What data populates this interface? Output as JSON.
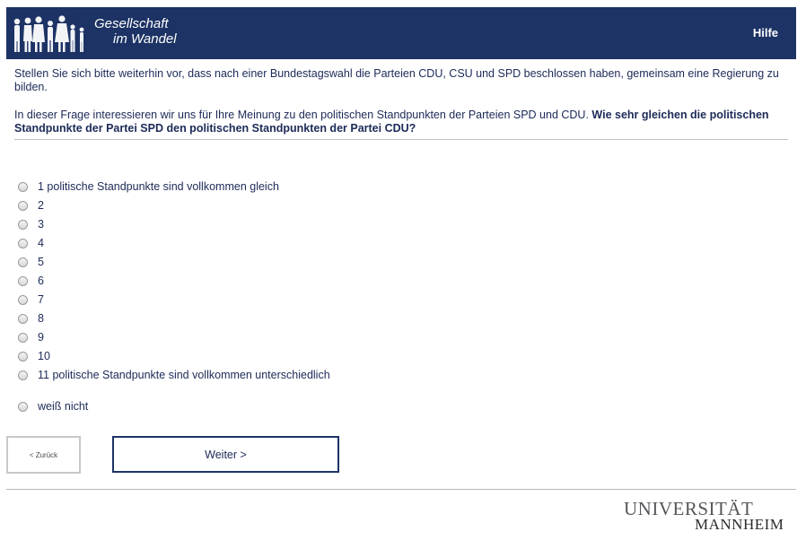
{
  "header": {
    "logo_line1": "Gesellschaft",
    "logo_line2": "im Wandel",
    "help_label": "Hilfe"
  },
  "intro_text": "Stellen Sie sich bitte weiterhin vor, dass nach einer Bundestagswahl die Parteien CDU, CSU und SPD beschlossen haben, gemeinsam eine Regierung zu bilden.",
  "question": {
    "plain": "In dieser Frage interessieren wir uns für Ihre Meinung zu den politischen Standpunkten der Parteien SPD und CDU. ",
    "bold": "Wie sehr gleichen die politischen Standpunkte der Partei SPD den politischen Standpunkten der Partei CDU?"
  },
  "options": [
    "1 politische Standpunkte sind vollkommen gleich",
    "2",
    "3",
    "4",
    "5",
    "6",
    "7",
    "8",
    "9",
    "10",
    "11 politische Standpunkte sind vollkommen unterschiedlich"
  ],
  "dont_know": "weiß nicht",
  "buttons": {
    "back": "< Zurück",
    "next": "Weiter >"
  },
  "footer": {
    "uni_line1": "UNIVERSITÄT",
    "uni_line2": "MANNHEIM"
  },
  "colors": {
    "header_bg": "#1d3365",
    "text": "#1c2a57"
  }
}
